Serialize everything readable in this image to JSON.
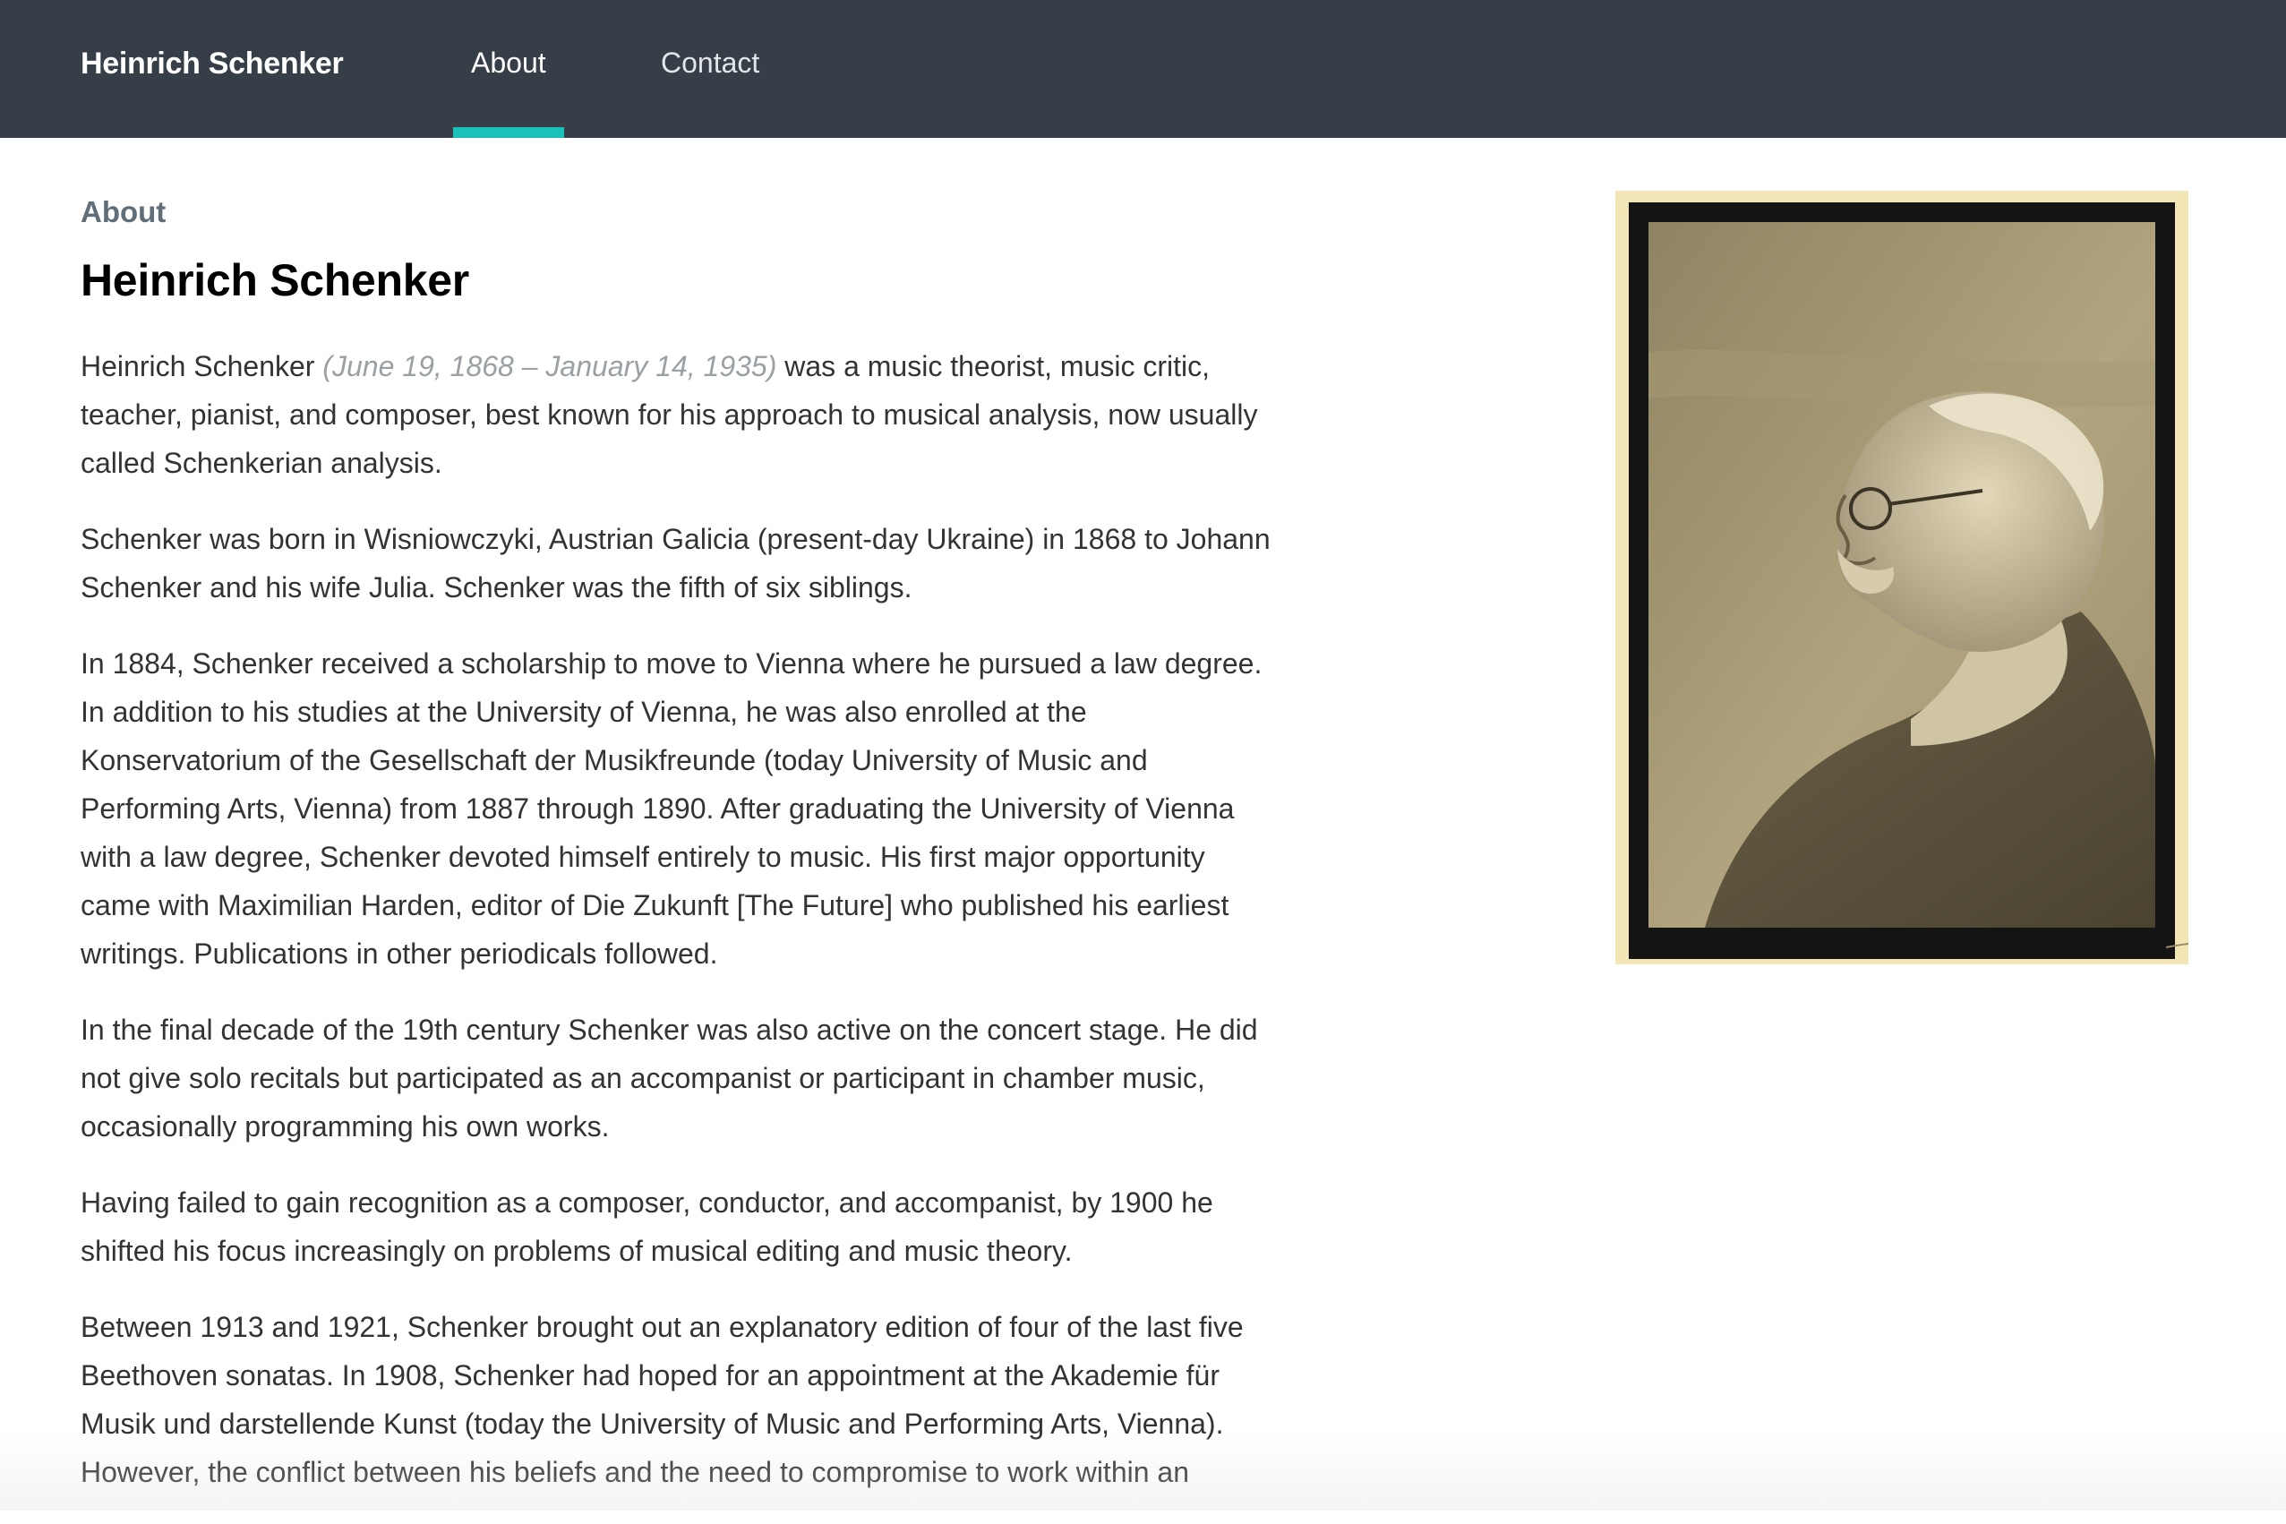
{
  "nav": {
    "brand": "Heinrich Schenker",
    "items": [
      {
        "label": "About",
        "active": true
      },
      {
        "label": "Contact",
        "active": false
      }
    ],
    "accent_color": "#1bc0b8",
    "bar_color": "#363f47"
  },
  "main": {
    "section_label": "About",
    "title": "Heinrich Schenker",
    "intro": {
      "name": "Heinrich Schenker",
      "dates": "(June 19, 1868 – January 14, 1935)",
      "rest": "was a music theorist, music critic, teacher, pianist, and composer, best known for his approach to musical analysis, now usually called Schenkerian analysis."
    },
    "paragraphs": [
      "Schenker was born in Wisniowczyki, Austrian Galicia (present-day Ukraine) in 1868 to Johann Schenker and his wife Julia. Schenker was the fifth of six siblings.",
      "In 1884, Schenker received a scholarship to move to Vienna where he pursued a law degree. In addition to his studies at the University of Vienna, he was also enrolled at the Konservatorium of the Gesellschaft der Musikfreunde (today University of Music and Performing Arts, Vienna) from 1887 through 1890. After graduating the University of Vienna with a law degree, Schenker devoted himself entirely to music. His first major opportunity came with Maximilian Harden, editor of Die Zukunft [The Future] who published his earliest writings. Publications in other periodicals followed.",
      "In the final decade of the 19th century Schenker was also active on the concert stage. He did not give solo recitals but participated as an accompanist or participant in chamber music, occasionally programming his own works.",
      "Having failed to gain recognition as a composer, conductor, and accompanist, by 1900 he shifted his focus increasingly on problems of musical editing and music theory.",
      "Between 1913 and 1921, Schenker brought out an explanatory edition of four of the last five Beethoven sonatas. In 1908, Schenker had hoped for an appointment at the Akademie für Musik und darstellende Kunst (today the University of Music and Performing Arts, Vienna). However, the conflict between his beliefs and the need to compromise to work within an"
    ]
  },
  "portrait": {
    "subject": "sepia profile portrait photograph of Heinrich Schenker",
    "mat_color": "#f3e6b6",
    "frame_color": "#141414"
  }
}
